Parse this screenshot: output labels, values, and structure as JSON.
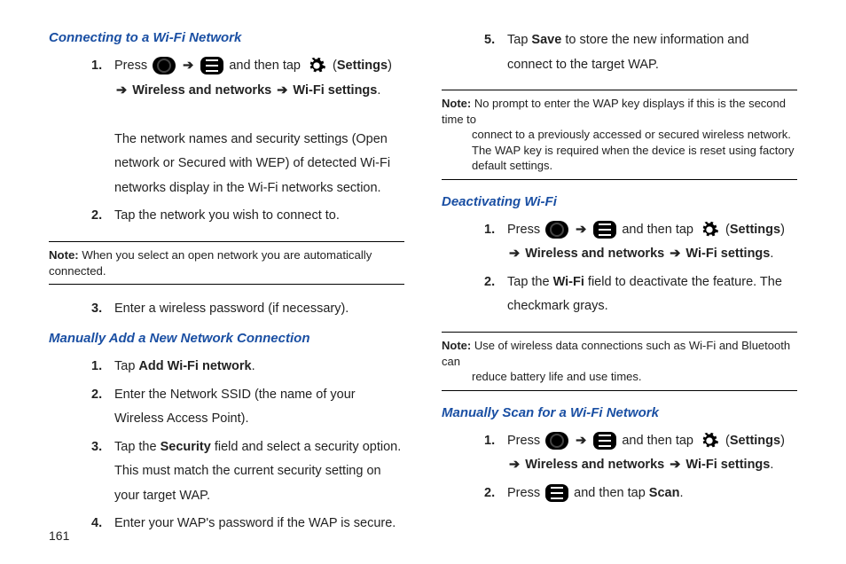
{
  "page_number": "161",
  "col1": {
    "heading1": "Connecting to a Wi-Fi Network",
    "step1_a": "Press ",
    "step1_b": " and then tap ",
    "step1_c": " (",
    "settings_label": "Settings",
    "step1_d": ") ",
    "wireless_label": "Wireless and networks",
    "wifi_settings_label": "Wi-Fi settings",
    "step1_desc": "The network names and security settings (Open network or Secured with WEP) of detected Wi-Fi networks display in the Wi-Fi networks section.",
    "step2": "Tap the network you wish to connect to.",
    "note1_label": "Note:",
    "note1_text": " When you select an open network you are automatically connected.",
    "step3": "Enter a wireless password (if necessary).",
    "heading2": "Manually Add a New Network Connection",
    "m_step1_a": "Tap ",
    "m_step1_b": "Add Wi-Fi network",
    "m_step2": "Enter the Network SSID (the name of your Wireless Access Point).",
    "m_step3_a": "Tap the ",
    "m_step3_b": "Security",
    "m_step3_c": " field and select a security option. This must match the current security setting on your target WAP.",
    "m_step4": "Enter your WAP's password if the WAP is secure."
  },
  "col2": {
    "step5_a": "Tap ",
    "step5_b": "Save",
    "step5_c": " to store the new information and connect to the target WAP.",
    "note2_label": "Note:",
    "note2_line1": " No prompt to enter the WAP key displays if this is the second time to",
    "note2_rest": "connect to a previously accessed or secured wireless network. The WAP key is required when the device is reset using factory default settings.",
    "heading3": "Deactivating Wi-Fi",
    "d_step1_a": "Press ",
    "d_step1_b": " and then tap ",
    "d_step1_c": " (",
    "d_step1_d": ") ",
    "d_step2_a": "Tap the ",
    "d_step2_b": "Wi-Fi",
    "d_step2_c": " field to deactivate the feature. The checkmark grays.",
    "note3_label": "Note:",
    "note3_line1": " Use of wireless data connections such as Wi-Fi and Bluetooth can",
    "note3_rest": "reduce battery life and use times.",
    "heading4": "Manually Scan for a Wi-Fi Network",
    "s_step1_a": "Press ",
    "s_step1_b": " and then tap ",
    "s_step1_c": " (",
    "s_step1_d": ") ",
    "s_step2_a": "Press ",
    "s_step2_b": " and then tap ",
    "s_step2_c": "Scan",
    "arrow": "➔",
    "period": "."
  }
}
